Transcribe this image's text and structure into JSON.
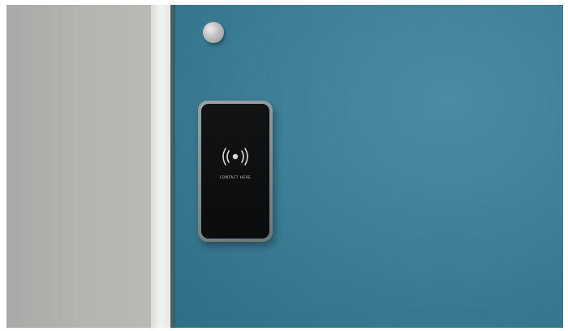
{
  "scene": {
    "description_tags": [
      "locker",
      "nfc-lock",
      "wall"
    ],
    "colors": {
      "grey_panel": "#b4b4b1",
      "white_strip": "#eeeeec",
      "teal_door": "#3f8096",
      "device_screen": "#0f1112"
    }
  },
  "device": {
    "icon": "nfc-icon",
    "text": "CONTACT HERE"
  }
}
